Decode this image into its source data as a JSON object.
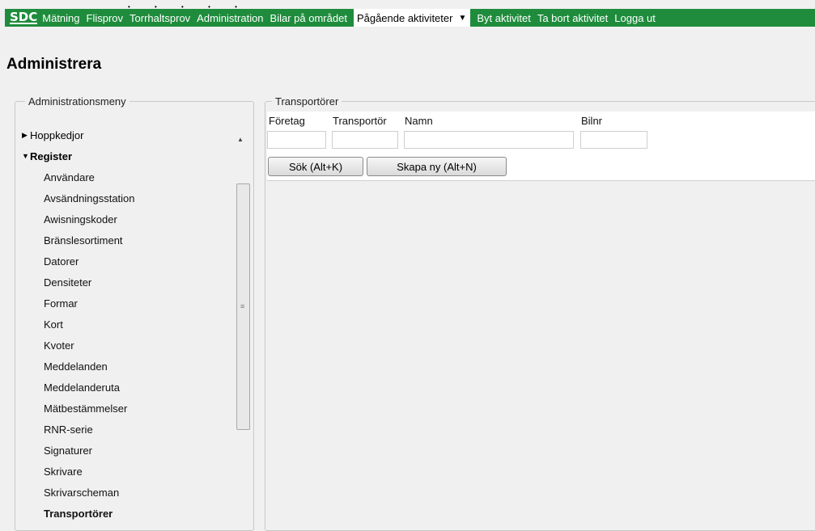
{
  "nav": {
    "logo": "SDC",
    "links": [
      "Mätning",
      "Flisprov",
      "Torrhaltsprov",
      "Administration",
      "Bilar på området"
    ],
    "active_dropdown": "Pågående aktiviteter",
    "links_after": [
      "Byt aktivitet",
      "Ta bort aktivitet",
      "Logga ut"
    ]
  },
  "page": {
    "title": "Administrera"
  },
  "admin_menu": {
    "legend": "Administrationsmeny",
    "groups": [
      {
        "label": "Hoppkedjor",
        "expanded": false
      },
      {
        "label": "Register",
        "expanded": true
      }
    ],
    "items": [
      "Användare",
      "Avsändningsstation",
      "Awisningskoder",
      "Bränslesortiment",
      "Datorer",
      "Densiteter",
      "Formar",
      "Kort",
      "Kvoter",
      "Meddelanden",
      "Meddelanderuta",
      "Mätbestämmelser",
      "RNR-serie",
      "Signaturer",
      "Skrivare",
      "Skrivarscheman",
      "Transportörer"
    ],
    "selected": "Transportörer"
  },
  "transport": {
    "legend": "Transportörer",
    "labels": {
      "foretag": "Företag",
      "transportor": "Transportör",
      "namn": "Namn",
      "bilnr": "Bilnr"
    },
    "values": {
      "foretag": "",
      "transportor": "",
      "namn": "",
      "bilnr": ""
    },
    "search_button": "Sök (Alt+K)",
    "create_button": "Skapa ny (Alt+N)"
  },
  "colors": {
    "nav_bg": "#1e8c3c",
    "nav_text": "#ffffff",
    "bg": "#f0f0f0"
  },
  "icons": [
    "triangle-right-icon",
    "triangle-down-icon",
    "caret-down-icon",
    "scroll-up-icon",
    "scroll-grip-icon"
  ]
}
